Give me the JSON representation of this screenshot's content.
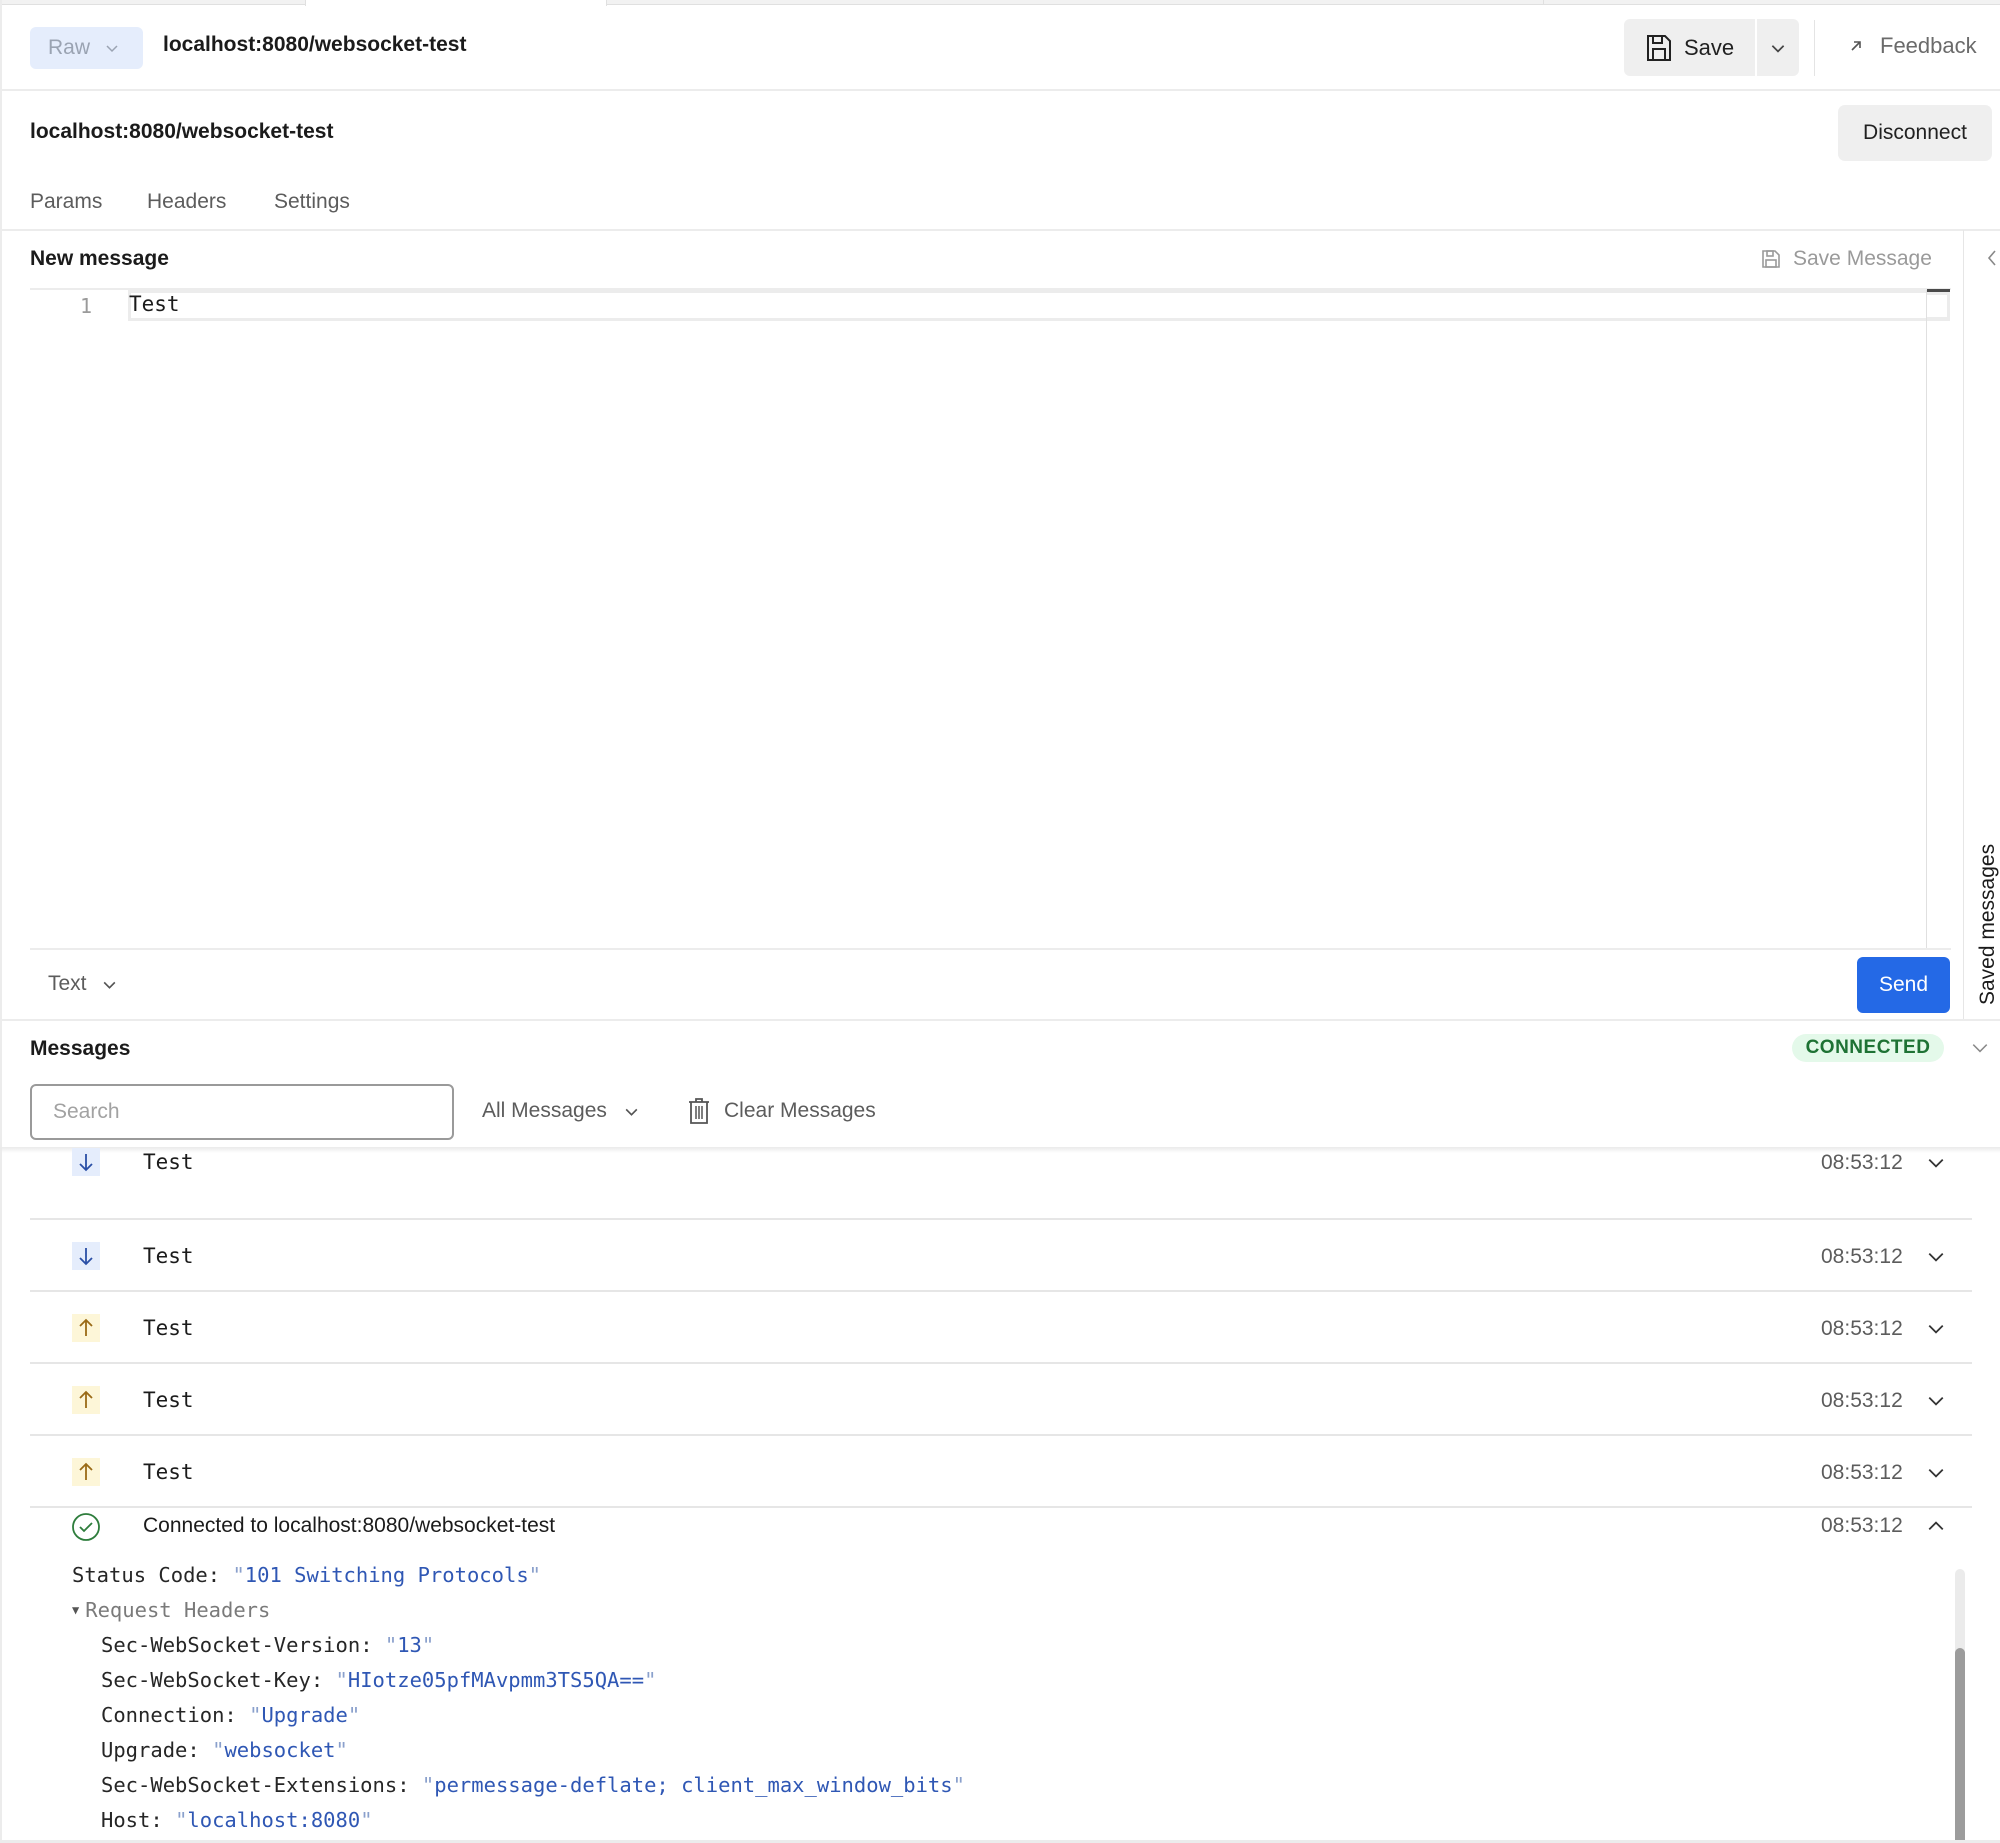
{
  "header": {
    "mode_label": "Raw",
    "request_title": "localhost:8080/websocket-test",
    "save_label": "Save",
    "feedback_label": "Feedback"
  },
  "connection": {
    "url": "localhost:8080/websocket-test",
    "disconnect_label": "Disconnect"
  },
  "tabs": [
    {
      "label": "Params"
    },
    {
      "label": "Headers"
    },
    {
      "label": "Settings"
    }
  ],
  "composer": {
    "title": "New message",
    "save_message_label": "Save Message",
    "line_number": "1",
    "code": "Test",
    "format": "Text",
    "send_label": "Send",
    "saved_messages_label": "Saved messages"
  },
  "messages": {
    "title": "Messages",
    "status": "CONNECTED",
    "status_color": "#1e7234",
    "search_placeholder": "Search",
    "search_value": "",
    "filter": "All Messages",
    "clear_label": "Clear Messages",
    "items": [
      {
        "direction": "incoming",
        "icon": "arrow-down-icon",
        "text": "Test",
        "time": "08:53:12"
      },
      {
        "direction": "incoming",
        "icon": "arrow-down-icon",
        "text": "Test",
        "time": "08:53:12"
      },
      {
        "direction": "outgoing",
        "icon": "arrow-up-icon",
        "text": "Test",
        "time": "08:53:12"
      },
      {
        "direction": "outgoing",
        "icon": "arrow-up-icon",
        "text": "Test",
        "time": "08:53:12"
      },
      {
        "direction": "outgoing",
        "icon": "arrow-up-icon",
        "text": "Test",
        "time": "08:53:12"
      }
    ],
    "connected_event": {
      "icon": "check-circle-icon",
      "text": "Connected to localhost:8080/websocket-test",
      "time": "08:53:12",
      "expanded": true,
      "status_code_key": "Status Code",
      "status_code_value": "101 Switching Protocols",
      "request_headers_label": "Request Headers",
      "request_headers": [
        {
          "key": "Sec-WebSocket-Version",
          "value": "13"
        },
        {
          "key": "Sec-WebSocket-Key",
          "value": "HIotze05pfMAvpmm3TS5QA=="
        },
        {
          "key": "Connection",
          "value": "Upgrade"
        },
        {
          "key": "Upgrade",
          "value": "websocket"
        },
        {
          "key": "Sec-WebSocket-Extensions",
          "value": "permessage-deflate; client_max_window_bits"
        },
        {
          "key": "Host",
          "value": "localhost:8080"
        }
      ]
    }
  },
  "colors": {
    "accent": "#2469e6",
    "incoming_bg": "#e5edfc",
    "incoming_fg": "#2a4fa6",
    "outgoing_bg": "#fdf6d8",
    "outgoing_fg": "#9a6a16",
    "success": "#2e7d3c",
    "string_value": "#2f57b4"
  }
}
